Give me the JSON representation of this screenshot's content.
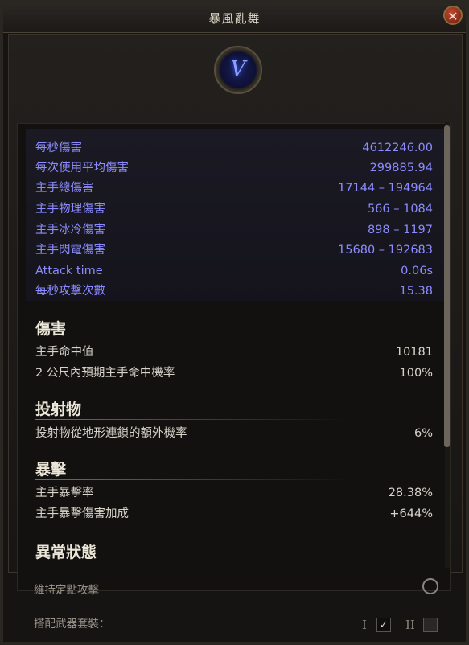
{
  "window": {
    "title": "暴風亂舞",
    "close_glyph": "✕"
  },
  "skill": {
    "icon_name": "skill-tempest-rush-icon",
    "icon_glyph": "V"
  },
  "stats": [
    {
      "label": "每秒傷害",
      "value": "4612246.00"
    },
    {
      "label": "每次使用平均傷害",
      "value": "299885.94"
    },
    {
      "label": "主手總傷害",
      "value": "17144 – 194964"
    },
    {
      "label": "主手物理傷害",
      "value": "566 – 1084"
    },
    {
      "label": "主手冰冷傷害",
      "value": "898 – 1197"
    },
    {
      "label": "主手閃電傷害",
      "value": "15680 – 192683"
    },
    {
      "label": "Attack time",
      "value": "0.06s"
    },
    {
      "label": "每秒攻擊次數",
      "value": "15.38"
    }
  ],
  "sections": {
    "damage": {
      "heading": "傷害",
      "rows": [
        {
          "label": "主手命中值",
          "value": "10181"
        },
        {
          "label": "2 公尺內預期主手命中機率",
          "value": "100%"
        }
      ]
    },
    "projectile": {
      "heading": "投射物",
      "rows": [
        {
          "label": "投射物從地形連鎖的額外機率",
          "value": "6%"
        }
      ]
    },
    "crit": {
      "heading": "暴擊",
      "rows": [
        {
          "label": "主手暴擊率",
          "value": "28.38%"
        },
        {
          "label": "主手暴擊傷害加成",
          "value": "+644%"
        }
      ]
    },
    "ailments": {
      "heading": "異常狀態"
    }
  },
  "options": {
    "stand_ground_label": "維持定點攻擊",
    "weapon_set_label": "搭配武器套裝：",
    "set1_numeral": "I",
    "set2_numeral": "II",
    "set1_check": "✓"
  },
  "colors": {
    "stat_blue": "#8c8cff",
    "text_light": "#d8d4ca",
    "background": "#161412"
  }
}
